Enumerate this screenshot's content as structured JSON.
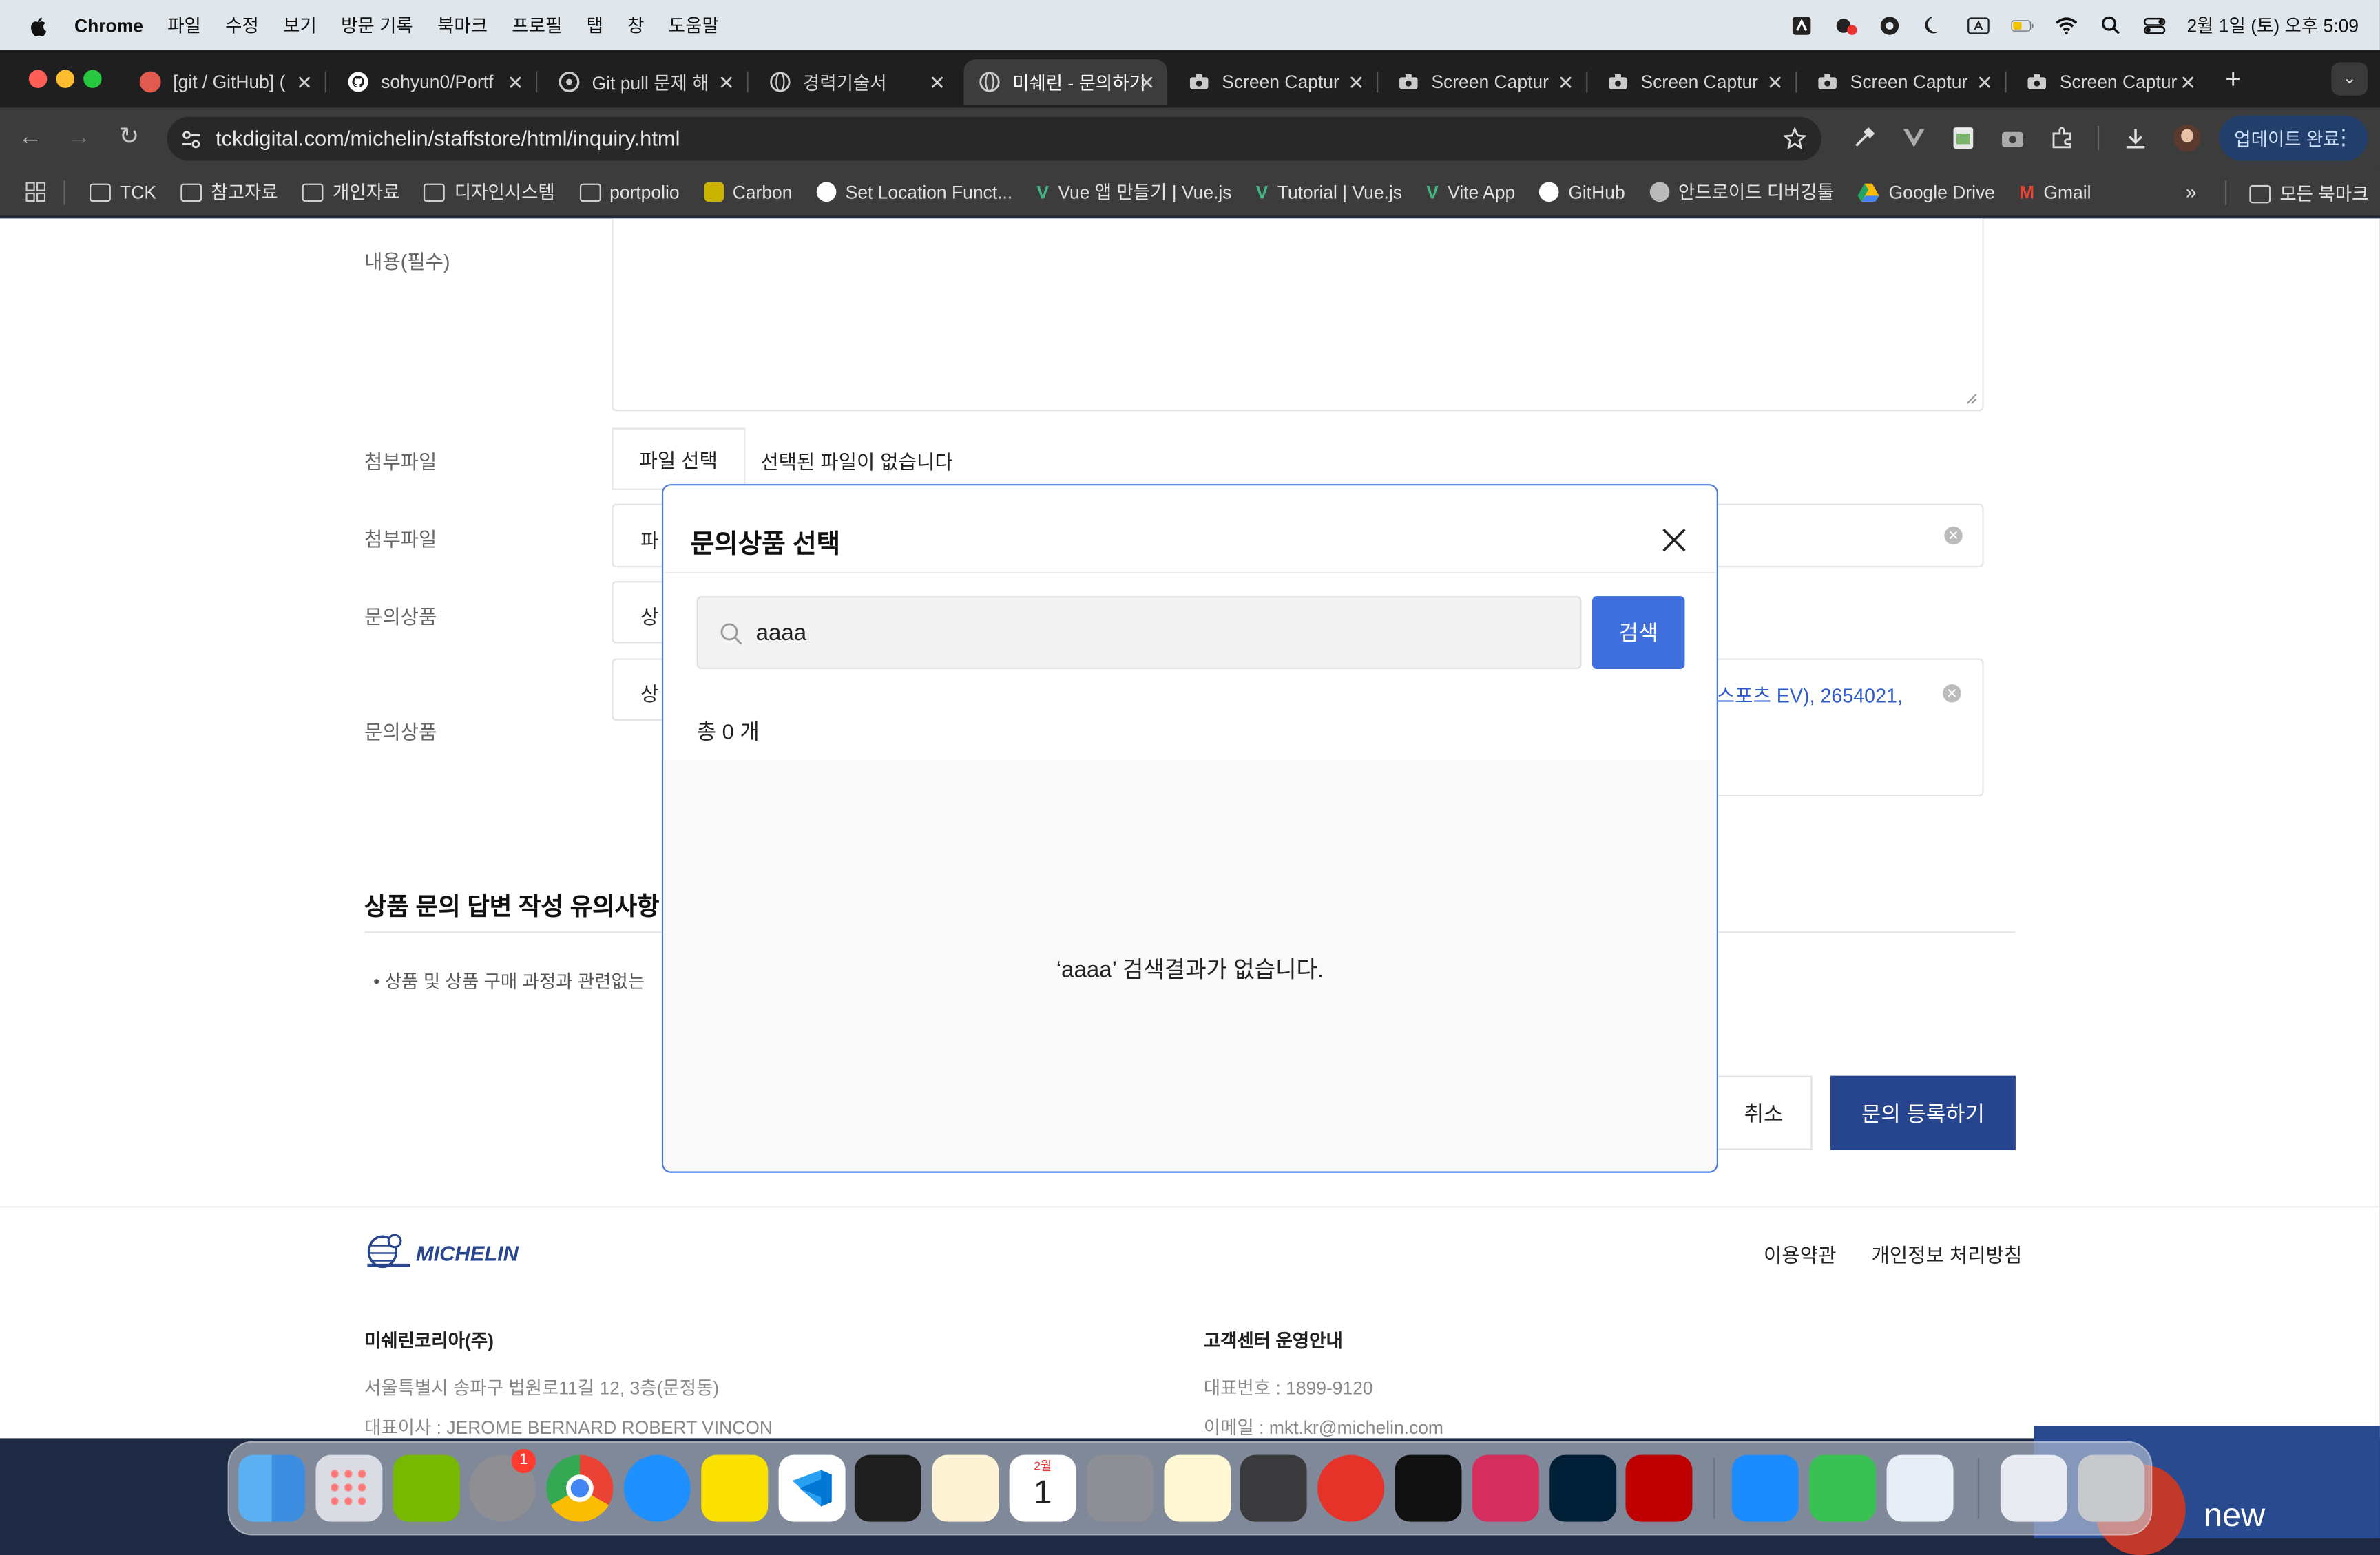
{
  "menubar": {
    "app": "Chrome",
    "items": [
      "파일",
      "수정",
      "보기",
      "방문 기록",
      "북마크",
      "프로필",
      "탭",
      "창",
      "도움말"
    ],
    "clock": "2월 1일 (토) 오후 5:09"
  },
  "tabs": [
    {
      "title": "[git / GitHub] (",
      "color": "#e05a4f"
    },
    {
      "title": "sohyun0/Portf",
      "color": "#ffffff"
    },
    {
      "title": "Git pull 문제 해",
      "color": "#bbbbbb"
    },
    {
      "title": "경력기술서",
      "color": "#bbbbbb"
    },
    {
      "title": "미쉐린 - 문의하기",
      "color": "#bbbbbb",
      "active": true
    },
    {
      "title": "Screen Captur",
      "color": "#cccccc"
    },
    {
      "title": "Screen Captur",
      "color": "#cccccc"
    },
    {
      "title": "Screen Captur",
      "color": "#cccccc"
    },
    {
      "title": "Screen Captur",
      "color": "#cccccc"
    },
    {
      "title": "Screen Captur",
      "color": "#cccccc"
    }
  ],
  "toolbar": {
    "url": "tckdigital.com/michelin/staffstore/html/inquiry.html",
    "update_label": "업데이트 완료"
  },
  "bookmarks": {
    "items": [
      {
        "label": "TCK",
        "kind": "folder"
      },
      {
        "label": "참고자료",
        "kind": "folder"
      },
      {
        "label": "개인자료",
        "kind": "folder"
      },
      {
        "label": "디자인시스템",
        "kind": "folder"
      },
      {
        "label": "portpolio",
        "kind": "folder"
      },
      {
        "label": "Carbon",
        "kind": "site",
        "color": "#c9b200"
      },
      {
        "label": "Set Location Funct...",
        "kind": "site",
        "color": "#ffffff"
      },
      {
        "label": "Vue 앱 만들기 | Vue.js",
        "kind": "site",
        "color": "#41b883"
      },
      {
        "label": "Tutorial | Vue.js",
        "kind": "site",
        "color": "#41b883"
      },
      {
        "label": "Vite App",
        "kind": "site",
        "color": "#41b883"
      },
      {
        "label": "GitHub",
        "kind": "site",
        "color": "#ffffff"
      },
      {
        "label": "안드로이드 디버깅툴",
        "kind": "site",
        "color": "#bbbbbb"
      },
      {
        "label": "Google Drive",
        "kind": "site",
        "color": "#fbbc04"
      },
      {
        "label": "Gmail",
        "kind": "site",
        "color": "#ea4335"
      }
    ],
    "all_label": "모든 북마크"
  },
  "form": {
    "content_label": "내용(필수)",
    "attach_label": "첨부파일",
    "attach_label2": "첨부파일",
    "file_button": "파일 선택",
    "no_file": "선택된 파일이 없습니다",
    "file_button2_partial": "파",
    "product_label": "문의상품",
    "product_label2": "문의상품",
    "product_button_partial": "상",
    "product_button2_partial": "상",
    "selected_product_partial": "스포츠 EV), 2654021,"
  },
  "notes": {
    "title_partial": "상품 문의 답변 작성 유의사항",
    "bullet_partial": "상품 및 상품 구매 과정과 관련없는"
  },
  "actions": {
    "cancel": "취소",
    "submit": "문의 등록하기"
  },
  "footer": {
    "logo": "MICHELIN",
    "terms": "이용약관",
    "privacy": "개인정보 처리방침",
    "company": "미쉐린코리아(주)",
    "address": "서울특별시 송파구 법원로11길 12, 3층(문정동)",
    "ceo": "대표이사 : JEROME BERNARD ROBERT VINCON",
    "cs_title": "고객센터 운영안내",
    "phone": "대표번호 : 1899-9120",
    "email": "이메일 : mkt.kr@michelin.com"
  },
  "modal": {
    "title": "문의상품 선택",
    "search_value": "aaaa",
    "search_button": "검색",
    "count_text": "총 0 개",
    "empty_text": "‘aaaa’ 검색결과가 없습니다."
  },
  "dock": {
    "settings_badge": "1",
    "calendar_month": "2월",
    "calendar_day": "1"
  },
  "wallpaper_text": "new"
}
